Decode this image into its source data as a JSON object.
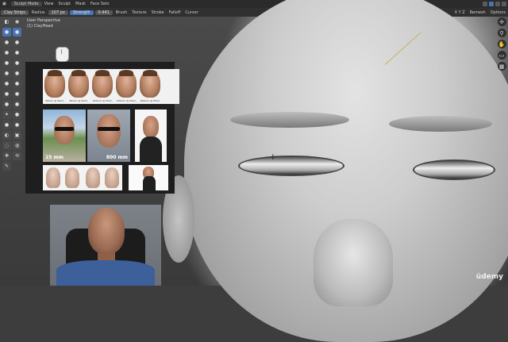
{
  "header": {
    "mode": "Sculpt Mode",
    "menus": [
      "View",
      "Sculpt",
      "Mask",
      "Face Sets"
    ],
    "right_menu": "Options"
  },
  "tool_header": {
    "brush_name": "Clay Strips",
    "radius_label": "Radius",
    "radius_value": "107 px",
    "strength_label": "Strength",
    "strength_value": "0.441",
    "items": [
      "Brush",
      "Texture",
      "Stroke",
      "Falloff",
      "Cursor"
    ],
    "symmetry": "X Y Z",
    "remesh": "Remesh",
    "options": "Options"
  },
  "viewport": {
    "perspective_label": "User Perspective",
    "object_label": "(1) ClayHead"
  },
  "reference_panel": {
    "row1_captions": [
      "50mm @ 50cm",
      "85mm @ 50cm",
      "105mm @ 50cm",
      "135mm @ 50cm",
      "200mm @ 50cm"
    ],
    "row2_labels": [
      "15 mm",
      "800 mm"
    ]
  },
  "toolbar_icons": [
    "select-icon",
    "cursor-icon",
    "draw-icon",
    "draw-sharp-icon",
    "clay-icon",
    "clay-strips-icon",
    "layer-icon",
    "inflate-icon",
    "blob-icon",
    "crease-icon",
    "smooth-icon",
    "flatten-icon",
    "fill-icon",
    "scrape-icon",
    "pinch-icon",
    "grab-icon",
    "snake-hook-icon",
    "thumb-icon",
    "pose-icon",
    "nudge-icon",
    "rotate-icon",
    "slide-relax-icon",
    "mask-icon",
    "box-mask-icon",
    "lasso-mask-icon",
    "face-set-icon",
    "move-icon",
    "transform-icon",
    "annotate-icon"
  ],
  "watermark": "üdemy",
  "colors": {
    "accent": "#4772b3",
    "header_bg": "#2b2b2b",
    "panel_bg": "#1e1e1e"
  }
}
